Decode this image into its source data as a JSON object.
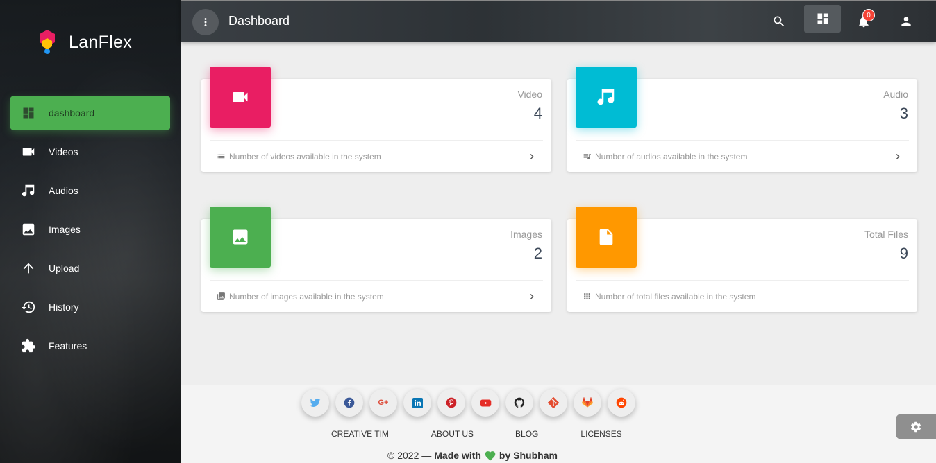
{
  "sidebar": {
    "app_name": "LanFlex",
    "items": [
      {
        "label": "dashboard",
        "icon": "dashboard-icon",
        "active": true
      },
      {
        "label": "Videos",
        "icon": "videocam-icon"
      },
      {
        "label": "Audios",
        "icon": "music-note-icon"
      },
      {
        "label": "Images",
        "icon": "image-icon"
      },
      {
        "label": "Upload",
        "icon": "arrow-up-icon"
      },
      {
        "label": "History",
        "icon": "history-icon"
      },
      {
        "label": "Features",
        "icon": "puzzle-icon"
      }
    ]
  },
  "topbar": {
    "title": "Dashboard",
    "notifications_count": "0"
  },
  "cards": [
    {
      "category": "Video",
      "value": "4",
      "footer": "Number of videos available in the system",
      "color": "#e91e63",
      "icon": "videocam-icon"
    },
    {
      "category": "Audio",
      "value": "3",
      "footer": "Number of audios available in the system",
      "color": "#00bcd4",
      "icon": "music-note-icon"
    },
    {
      "category": "Images",
      "value": "2",
      "footer": "Number of images available in the system",
      "color": "#4caf50",
      "icon": "image-icon"
    },
    {
      "category": "Total Files",
      "value": "9",
      "footer": "Number of total files available in the system",
      "color": "#ff9800",
      "icon": "file-icon"
    }
  ],
  "footer": {
    "social": [
      "twitter",
      "facebook",
      "google-plus",
      "linkedin",
      "pinterest",
      "youtube",
      "github",
      "git",
      "gitlab",
      "reddit"
    ],
    "links": [
      "CREATIVE TIM",
      "ABOUT US",
      "BLOG",
      "LICENSES"
    ],
    "copyright_prefix": "© 2022 —",
    "made_with": "Made with",
    "by": "by Shubham"
  },
  "colors": {
    "accent": "#4caf50",
    "video": "#e91e63",
    "audio": "#00bcd4",
    "images": "#4caf50",
    "files": "#ff9800"
  }
}
